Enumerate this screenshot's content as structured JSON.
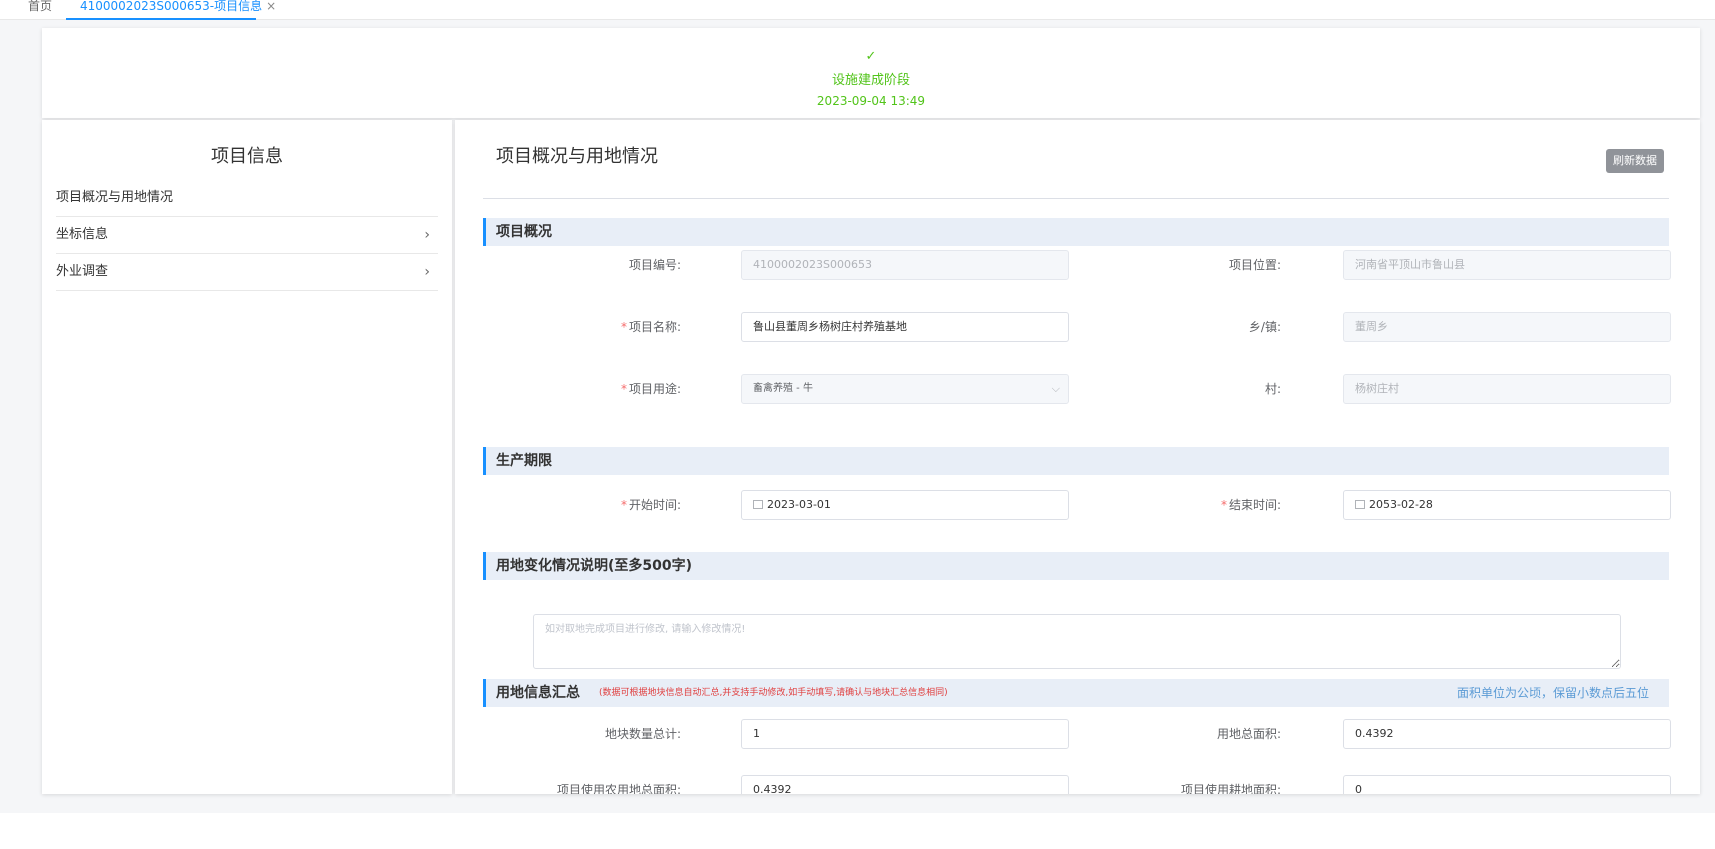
{
  "tabs": {
    "home": "首页",
    "active": "4100002023S000653-项目信息",
    "close_glyph": "×"
  },
  "status": {
    "icon": "check-icon",
    "check_glyph": "✓",
    "stage": "设施建成阶段",
    "time": "2023-09-04 13:49",
    "color": "#52c41a"
  },
  "sidebar": {
    "title": "项目信息",
    "items": [
      {
        "label": "项目概况与用地情况",
        "chevron": ""
      },
      {
        "label": "坐标信息",
        "chevron": "›"
      },
      {
        "label": "外业调查",
        "chevron": "›"
      }
    ]
  },
  "main": {
    "title": "项目概况与用地情况",
    "refresh_label": "刷新数据",
    "sections": {
      "overview": "项目概况",
      "period": "生产期限",
      "change": "用地变化情况说明(至多500字)",
      "summary": "用地信息汇总",
      "summary_note": "(数据可根据地块信息自动汇总,并支持手动修改,如手动填写,请确认与地块汇总信息相同)",
      "summary_unit": "面积单位为公顷，保留小数点后五位"
    },
    "fields": {
      "project_no": {
        "label": "项目编号:",
        "value": "4100002023S000653",
        "required": false
      },
      "location": {
        "label": "项目位置:",
        "value": "河南省平顶山市鲁山县",
        "required": false
      },
      "name": {
        "label": "项目名称:",
        "value": "鲁山县董周乡杨树庄村养殖基地",
        "required": true
      },
      "town": {
        "label": "乡/镇:",
        "value": "董周乡",
        "required": false
      },
      "usage": {
        "label": "项目用途:",
        "value": "畜禽养殖 - 牛",
        "required": true
      },
      "village": {
        "label": "村:",
        "value": "杨树庄村",
        "required": false
      },
      "start": {
        "label": "开始时间:",
        "value": "2023-03-01",
        "required": true
      },
      "end": {
        "label": "结束时间:",
        "value": "2053-02-28",
        "required": true
      },
      "change_desc": {
        "placeholder": "如对取地完成项目进行修改, 请输入修改情况!",
        "value": ""
      },
      "plot_count": {
        "label": "地块数量总计:",
        "value": "1"
      },
      "total_area": {
        "label": "用地总面积:",
        "value": "0.4392"
      },
      "farmland_area": {
        "label": "项目使用农用地总面积:",
        "value": "0.4392"
      },
      "cultivated_area": {
        "label": "项目使用耕地面积:",
        "value": "0"
      }
    },
    "required_mark": "*",
    "chevron_glyph": "⌵"
  },
  "colors": {
    "accent": "#1890ff",
    "success": "#52c41a",
    "section_bg": "#e8eef7",
    "required": "#f56c6c",
    "button_gray": "#909399"
  }
}
